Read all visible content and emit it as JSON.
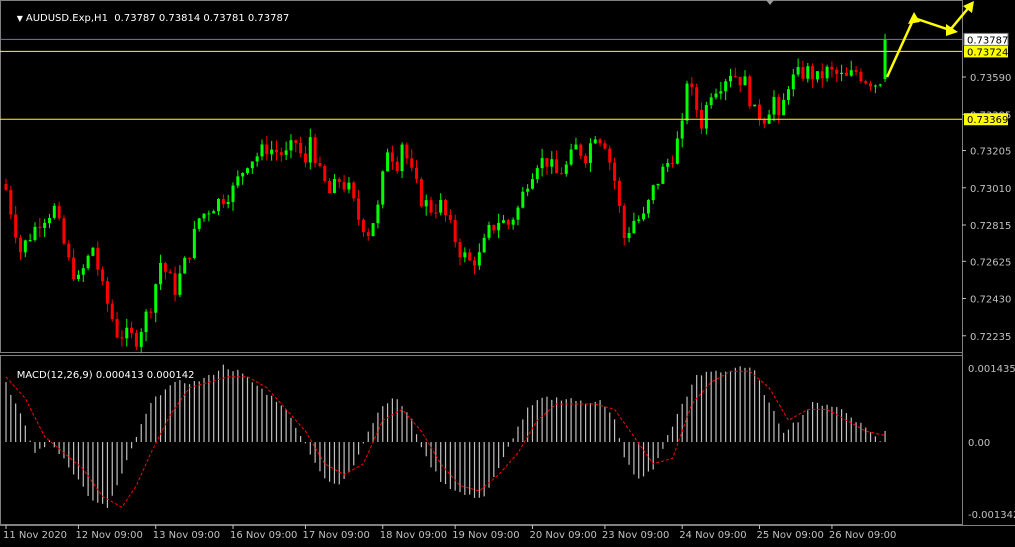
{
  "header": {
    "symbol": "AUDUSD.Exp,H1",
    "ohlc": "0.73787 0.73814 0.73781 0.73787"
  },
  "macd_header": {
    "label": "MACD(12,26,9)",
    "values": "0.000413 0.000142"
  },
  "colors": {
    "background": "#000000",
    "bull": "#00ff00",
    "bear": "#ff0000",
    "level_line": "#ffff00",
    "grid_text": "#c0c0c0",
    "macd_hist": "#c0c0c0",
    "macd_signal": "#ff0000",
    "arrow": "#ffff00"
  },
  "chart_data": [
    {
      "type": "candlestick",
      "title": "AUDUSD.Exp,H1",
      "y_ticks": [
        "0.73590",
        "0.73395",
        "0.73205",
        "0.73010",
        "0.72815",
        "0.72625",
        "0.72430",
        "0.72235"
      ],
      "ylim": [
        0.7215,
        0.7392
      ],
      "x_tick_labels": [
        "11 Nov 2020",
        "12 Nov 09:00",
        "13 Nov 09:00",
        "16 Nov 09:00",
        "17 Nov 09:00",
        "18 Nov 09:00",
        "19 Nov 09:00",
        "20 Nov 09:00",
        "23 Nov 09:00",
        "24 Nov 09:00",
        "25 Nov 09:00",
        "26 Nov 09:00"
      ],
      "x_tick_bars": [
        0,
        15,
        31,
        47,
        62,
        78,
        93,
        109,
        124,
        140,
        156,
        171
      ],
      "current_price": {
        "label": "0.73787",
        "value": 0.73787
      },
      "levels": [
        {
          "label": "0.73724",
          "value": 0.73724
        },
        {
          "label": "0.73369",
          "value": 0.73369
        }
      ],
      "close_anchors": [
        [
          0,
          0.73
        ],
        [
          3,
          0.7268
        ],
        [
          7,
          0.7284
        ],
        [
          10,
          0.729
        ],
        [
          13,
          0.7262
        ],
        [
          15,
          0.7252
        ],
        [
          18,
          0.727
        ],
        [
          20,
          0.7248
        ],
        [
          23,
          0.7225
        ],
        [
          27,
          0.7222
        ],
        [
          30,
          0.724
        ],
        [
          32,
          0.7262
        ],
        [
          35,
          0.7248
        ],
        [
          38,
          0.7268
        ],
        [
          40,
          0.7285
        ],
        [
          42,
          0.729
        ],
        [
          44,
          0.7294
        ],
        [
          47,
          0.73
        ],
        [
          50,
          0.7315
        ],
        [
          52,
          0.7318
        ],
        [
          54,
          0.7322
        ],
        [
          58,
          0.7318
        ],
        [
          60,
          0.7325
        ],
        [
          62,
          0.7312
        ],
        [
          63,
          0.7328
        ],
        [
          65,
          0.7308
        ],
        [
          67,
          0.7298
        ],
        [
          69,
          0.7305
        ],
        [
          71,
          0.73
        ],
        [
          73,
          0.7285
        ],
        [
          75,
          0.7278
        ],
        [
          77,
          0.729
        ],
        [
          79,
          0.7322
        ],
        [
          81,
          0.7314
        ],
        [
          82,
          0.7325
        ],
        [
          84,
          0.7308
        ],
        [
          86,
          0.7295
        ],
        [
          88,
          0.729
        ],
        [
          90,
          0.7292
        ],
        [
          92,
          0.728
        ],
        [
          94,
          0.7268
        ],
        [
          96,
          0.7262
        ],
        [
          98,
          0.7265
        ],
        [
          100,
          0.7278
        ],
        [
          102,
          0.7284
        ],
        [
          104,
          0.7282
        ],
        [
          106,
          0.729
        ],
        [
          108,
          0.7305
        ],
        [
          110,
          0.7315
        ],
        [
          112,
          0.7315
        ],
        [
          114,
          0.7308
        ],
        [
          116,
          0.7312
        ],
        [
          118,
          0.7322
        ],
        [
          120,
          0.7318
        ],
        [
          122,
          0.733
        ],
        [
          124,
          0.7325
        ],
        [
          126,
          0.7305
        ],
        [
          128,
          0.7275
        ],
        [
          130,
          0.7284
        ],
        [
          132,
          0.7285
        ],
        [
          134,
          0.73
        ],
        [
          136,
          0.731
        ],
        [
          138,
          0.7318
        ],
        [
          140,
          0.7332
        ],
        [
          141,
          0.7358
        ],
        [
          142,
          0.735
        ],
        [
          144,
          0.7335
        ],
        [
          146,
          0.7352
        ],
        [
          148,
          0.7356
        ],
        [
          150,
          0.7362
        ],
        [
          152,
          0.7358
        ],
        [
          153,
          0.7356
        ],
        [
          155,
          0.734
        ],
        [
          157,
          0.7338
        ],
        [
          159,
          0.7348
        ],
        [
          160,
          0.7335
        ],
        [
          162,
          0.7356
        ],
        [
          164,
          0.736
        ],
        [
          166,
          0.7362
        ],
        [
          168,
          0.7358
        ],
        [
          170,
          0.7362
        ],
        [
          172,
          0.736
        ],
        [
          174,
          0.7358
        ],
        [
          176,
          0.7362
        ],
        [
          178,
          0.7358
        ],
        [
          180,
          0.7356
        ],
        [
          181,
          0.7358
        ]
      ],
      "last_bar_close": 0.73787
    },
    {
      "type": "bar",
      "title": "MACD(12,26,9)",
      "y_ticks": [
        "0.001435",
        "0.00",
        "-0.001342"
      ],
      "ylim": [
        -0.001342,
        0.001435
      ],
      "histogram_anchors": [
        [
          0,
          0.0011
        ],
        [
          3,
          0.0005
        ],
        [
          6,
          -0.0002
        ],
        [
          9,
          0.0
        ],
        [
          12,
          -0.0003
        ],
        [
          15,
          -0.0007
        ],
        [
          18,
          -0.0011
        ],
        [
          21,
          -0.0012
        ],
        [
          24,
          -0.0006
        ],
        [
          27,
          0.0001
        ],
        [
          30,
          0.0007
        ],
        [
          33,
          0.001
        ],
        [
          36,
          0.0011
        ],
        [
          39,
          0.0011
        ],
        [
          42,
          0.0012
        ],
        [
          45,
          0.0014
        ],
        [
          48,
          0.0013
        ],
        [
          51,
          0.0011
        ],
        [
          54,
          0.0009
        ],
        [
          57,
          0.0007
        ],
        [
          60,
          0.0003
        ],
        [
          63,
          -0.0002
        ],
        [
          66,
          -0.0007
        ],
        [
          69,
          -0.0008
        ],
        [
          72,
          -0.0004
        ],
        [
          75,
          0.0002
        ],
        [
          78,
          0.0007
        ],
        [
          81,
          0.0008
        ],
        [
          84,
          0.0004
        ],
        [
          87,
          -0.0003
        ],
        [
          90,
          -0.0007
        ],
        [
          93,
          -0.0009
        ],
        [
          96,
          -0.001
        ],
        [
          99,
          -0.001
        ],
        [
          102,
          -0.0005
        ],
        [
          105,
          0.0001
        ],
        [
          108,
          0.0006
        ],
        [
          111,
          0.0008
        ],
        [
          114,
          0.0008
        ],
        [
          117,
          0.0008
        ],
        [
          120,
          0.0007
        ],
        [
          123,
          0.0008
        ],
        [
          126,
          0.0004
        ],
        [
          128,
          -0.0003
        ],
        [
          131,
          -0.0007
        ],
        [
          134,
          -0.0005
        ],
        [
          137,
          0.0001
        ],
        [
          140,
          0.0007
        ],
        [
          143,
          0.0012
        ],
        [
          146,
          0.0013
        ],
        [
          149,
          0.0013
        ],
        [
          152,
          0.0014
        ],
        [
          155,
          0.0013
        ],
        [
          158,
          0.0007
        ],
        [
          161,
          0.0002
        ],
        [
          164,
          0.0004
        ],
        [
          167,
          0.0007
        ],
        [
          170,
          0.0007
        ],
        [
          173,
          0.0006
        ],
        [
          176,
          0.0004
        ],
        [
          179,
          0.0002
        ],
        [
          181,
          0.0
        ],
        [
          183,
          0.0004
        ]
      ],
      "signal_anchors": [
        [
          0,
          0.0012
        ],
        [
          4,
          0.0008
        ],
        [
          8,
          0.0001
        ],
        [
          12,
          -0.0002
        ],
        [
          16,
          -0.0005
        ],
        [
          20,
          -0.001
        ],
        [
          24,
          -0.0012
        ],
        [
          27,
          -0.0008
        ],
        [
          30,
          -0.0002
        ],
        [
          34,
          0.0005
        ],
        [
          38,
          0.001
        ],
        [
          42,
          0.0011
        ],
        [
          46,
          0.0012
        ],
        [
          50,
          0.0012
        ],
        [
          54,
          0.001
        ],
        [
          58,
          0.0006
        ],
        [
          62,
          0.0002
        ],
        [
          66,
          -0.0004
        ],
        [
          70,
          -0.0006
        ],
        [
          74,
          -0.0004
        ],
        [
          78,
          0.0004
        ],
        [
          82,
          0.0006
        ],
        [
          86,
          0.0002
        ],
        [
          90,
          -0.0004
        ],
        [
          94,
          -0.0008
        ],
        [
          98,
          -0.0009
        ],
        [
          102,
          -0.0006
        ],
        [
          106,
          -0.0002
        ],
        [
          110,
          0.0004
        ],
        [
          114,
          0.0007
        ],
        [
          118,
          0.0007
        ],
        [
          122,
          0.0007
        ],
        [
          126,
          0.0006
        ],
        [
          130,
          0.0001
        ],
        [
          134,
          -0.0004
        ],
        [
          138,
          -0.0003
        ],
        [
          142,
          0.0007
        ],
        [
          146,
          0.0011
        ],
        [
          150,
          0.0013
        ],
        [
          154,
          0.0013
        ],
        [
          158,
          0.001
        ],
        [
          162,
          0.0004
        ],
        [
          166,
          0.0006
        ],
        [
          170,
          0.0006
        ],
        [
          174,
          0.0004
        ],
        [
          178,
          0.0002
        ],
        [
          183,
          0.0001
        ]
      ]
    }
  ]
}
